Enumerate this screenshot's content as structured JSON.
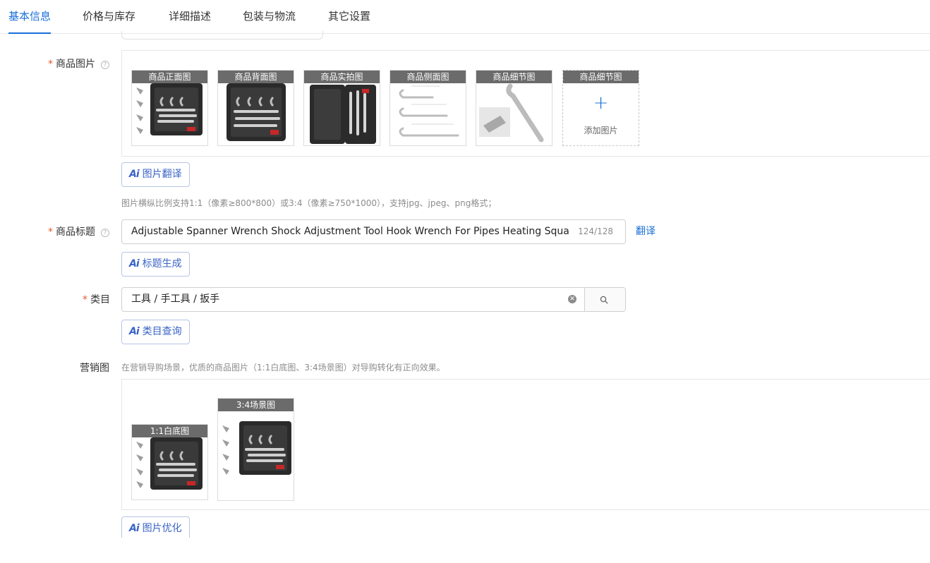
{
  "tabs": [
    {
      "label": "基本信息",
      "active": true
    },
    {
      "label": "价格与库存",
      "active": false
    },
    {
      "label": "详细描述",
      "active": false
    },
    {
      "label": "包装与物流",
      "active": false
    },
    {
      "label": "其它设置",
      "active": false
    }
  ],
  "images": {
    "label": "商品图片",
    "required_mark": "*",
    "slots": [
      "商品正面图",
      "商品背面图",
      "商品实拍图",
      "商品侧面图",
      "商品细节图",
      "商品细节图"
    ],
    "add_label": "添加图片",
    "ai_button": "图片翻译",
    "hint": "图片横纵比例支持1:1（像素≥800*800）或3:4（像素≥750*1000），支持jpg、jpeg、png格式；"
  },
  "title": {
    "label": "商品标题",
    "required_mark": "*",
    "value": "Adjustable Spanner Wrench Shock Adjustment Tool Hook  Wrench For Pipes Heating Square",
    "counter": "124/128",
    "translate_link": "翻译",
    "ai_button": "标题生成"
  },
  "category": {
    "label": "类目",
    "required_mark": "*",
    "value": "工具 / 手工具 / 扳手",
    "ai_button": "类目查询"
  },
  "marketing": {
    "label": "营销图",
    "hint": "在营销导购场景，优质的商品图片（1:1白底图、3:4场景图）对导购转化有正向效果。",
    "slots": [
      "1:1白底图",
      "3:4场景图"
    ],
    "ai_button": "图片优化"
  },
  "ai_prefix": "Ai",
  "colors": {
    "accent": "#1a6fd8",
    "required": "#e25b2a",
    "ai_text": "#3b64c6"
  }
}
